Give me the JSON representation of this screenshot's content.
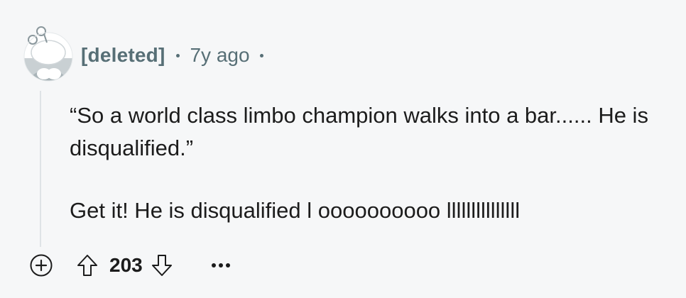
{
  "comment": {
    "author": "[deleted]",
    "age": "7y ago",
    "paragraphs": [
      "“So a world class limbo champion walks into a bar...... He is disqualified.”",
      "Get it! He is disqualified l oooooooooo lllllllllllllll"
    ],
    "score": "203"
  },
  "icons": {
    "avatar": "deleted-user-snoo-icon",
    "expand": "plus-circle-icon",
    "upvote": "arrow-up-icon",
    "downvote": "arrow-down-icon",
    "more": "ellipsis-icon"
  },
  "colors": {
    "background": "#f6f7f8",
    "meta_text": "#576f76",
    "body_text": "#1c1c1c",
    "thread_line": "#dfe3e6"
  }
}
